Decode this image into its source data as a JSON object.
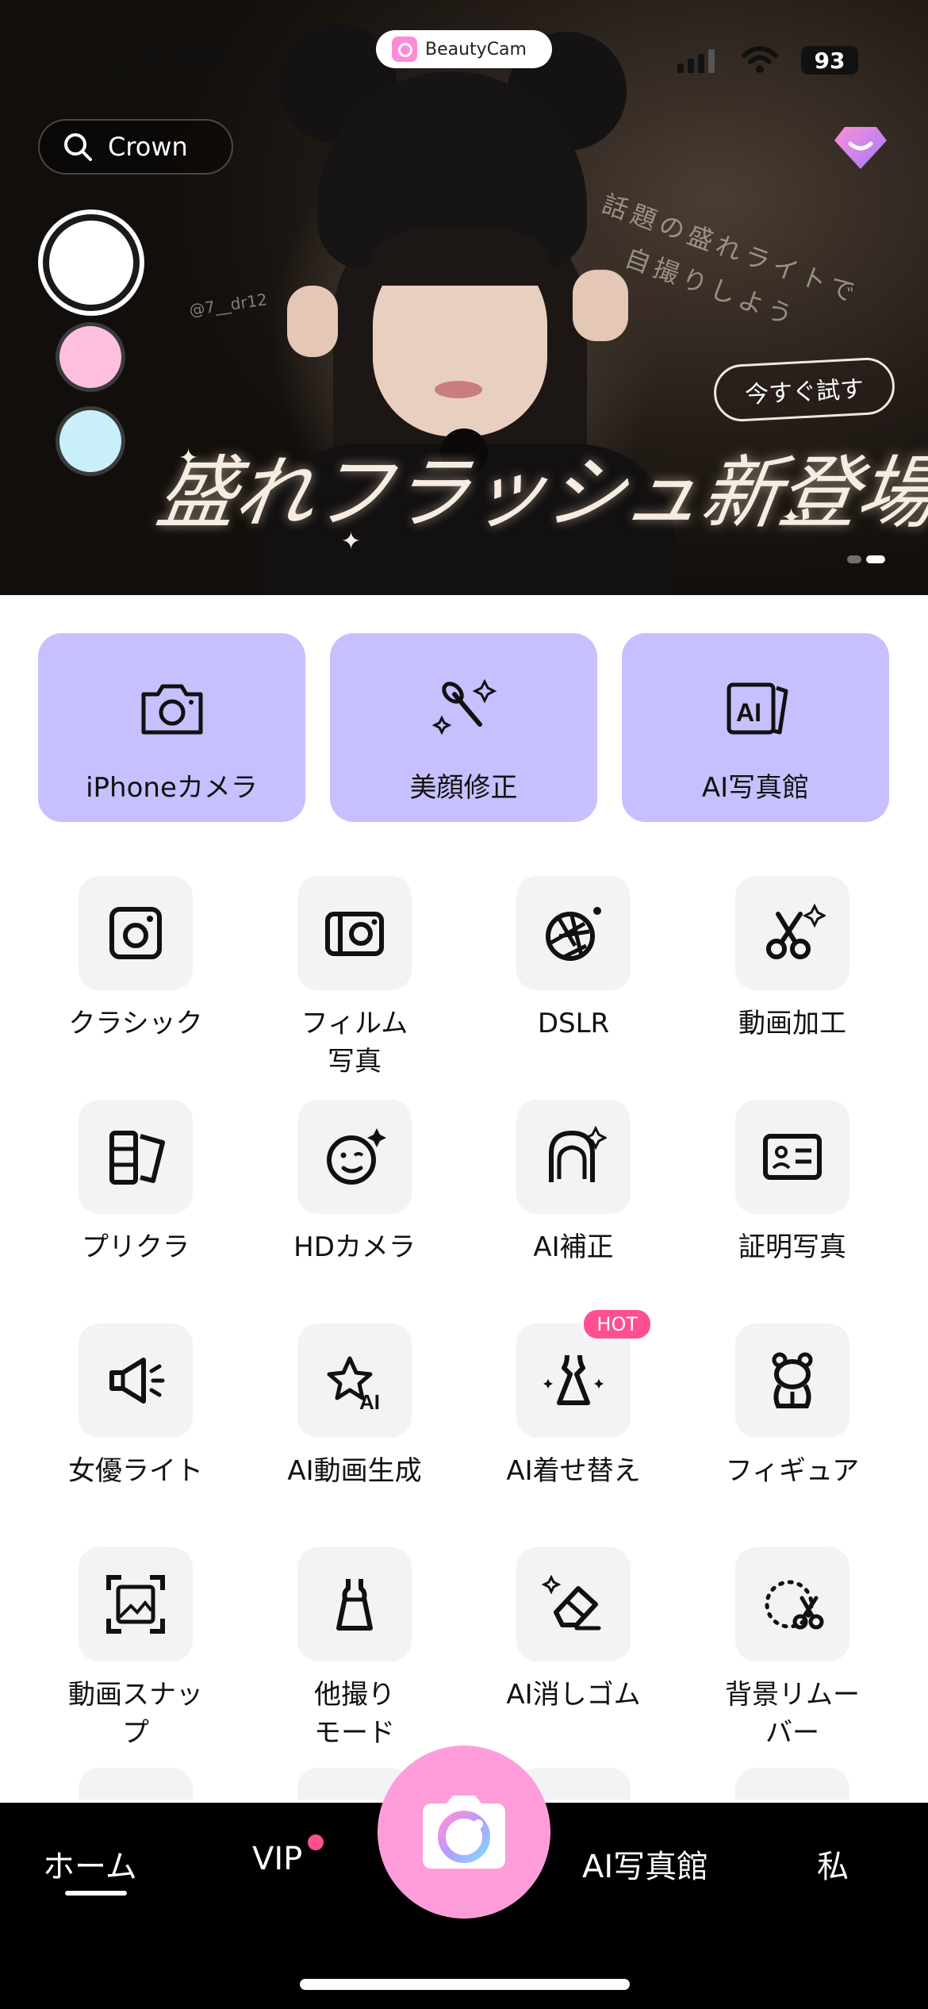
{
  "status": {
    "time": "12:07",
    "battery": "93"
  },
  "hero": {
    "brand": "BeautyCam",
    "search": "Crown",
    "watermark": "@7__dr12",
    "tagline_1": "話題の盛れライトで",
    "tagline_2": "自撮りしよう",
    "try_button": "今すぐ試す",
    "headline": "盛れフラッシュ新登場",
    "swatch_colors": [
      "#ffffff",
      "#ffc0e0",
      "#c9f0fa"
    ]
  },
  "cards": [
    {
      "label": "iPhoneカメラ",
      "icon": "camera-icon"
    },
    {
      "label": "美顔修正",
      "icon": "makeup-brush-icon"
    },
    {
      "label": "AI写真館",
      "icon": "ai-photo-icon"
    }
  ],
  "tools": [
    {
      "label": "クラシック",
      "icon": "instagram-camera-icon"
    },
    {
      "label": "フィルム\n写真",
      "icon": "film-camera-icon"
    },
    {
      "label": "DSLR",
      "icon": "aperture-icon"
    },
    {
      "label": "動画加工",
      "icon": "scissors-icon"
    },
    {
      "label": "プリクラ",
      "icon": "photo-strip-icon"
    },
    {
      "label": "HDカメラ",
      "icon": "face-sparkle-icon"
    },
    {
      "label": "AI補正",
      "icon": "hair-portrait-icon"
    },
    {
      "label": "証明写真",
      "icon": "id-card-icon"
    },
    {
      "label": "女優ライト",
      "icon": "megaphone-light-icon"
    },
    {
      "label": "AI動画生成",
      "icon": "ai-star-icon"
    },
    {
      "label": "AI着せ替え",
      "icon": "dress-icon",
      "badge": "HOT"
    },
    {
      "label": "フィギュア",
      "icon": "figure-bear-icon"
    },
    {
      "label": "動画スナッ\nプ",
      "icon": "image-frame-icon"
    },
    {
      "label": "他撮り\nモード",
      "icon": "dress-outline-icon"
    },
    {
      "label": "AI消しゴム",
      "icon": "eraser-icon"
    },
    {
      "label": "背景リムー\nバー",
      "icon": "cut-circle-icon"
    }
  ],
  "nav": {
    "home": "ホーム",
    "vip": "VIP",
    "studio": "AI写真館",
    "me": "私"
  },
  "colors": {
    "card": "#c6c0ff",
    "accent": "#ff4f92",
    "fab": "#ff9ddb",
    "tile": "#f3f3f5"
  }
}
